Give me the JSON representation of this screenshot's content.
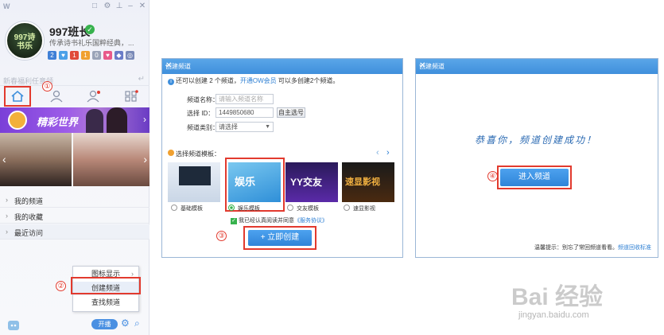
{
  "client": {
    "username": "997班长",
    "signature": "传承诗书礼乐国粹经典，...",
    "avatar_text": "997诗书乐",
    "badges": [
      {
        "text": "2",
        "color": "#3f7fd6"
      },
      {
        "text": "♥",
        "color": "#4aa0e8"
      },
      {
        "text": "1",
        "color": "#e04a3a"
      },
      {
        "text": "1",
        "color": "#f0a030"
      },
      {
        "text": "0",
        "color": "#9aa3b8"
      }
    ],
    "search_placeholder": "新春福利任意领",
    "banner_text": "精彩世界",
    "channels": [
      {
        "label": "我的频道"
      },
      {
        "label": "我的收藏"
      },
      {
        "label": "最近访问"
      }
    ],
    "context_menu": [
      {
        "label": "图标显示"
      },
      {
        "label": "创建频道"
      },
      {
        "label": "查找频道"
      }
    ],
    "open_label": "开播",
    "steps": [
      "①",
      "②",
      "③",
      "④"
    ]
  },
  "dialog1": {
    "title": "创建频道",
    "info_prefix": "还可以创建 2 个频道，",
    "info_link": "开通OW会员",
    "info_suffix": " 可以多创建2个频道。",
    "name_label": "频道名称：",
    "name_placeholder": "请输入频道名称",
    "id_label": "选择 ID：",
    "id_value": "1449850680",
    "id_button": "自主选号",
    "category_label": "频道类别：",
    "category_value": "请选择",
    "template_label": "选择频道模板：",
    "templates": [
      {
        "label": "基础模板",
        "thumb_text": ""
      },
      {
        "label": "娱乐模板",
        "thumb_text": "娱乐"
      },
      {
        "label": "交友模板",
        "thumb_text": "YY交友"
      },
      {
        "label": "速显影视",
        "thumb_text": "速显影视"
      }
    ],
    "agree_text": "我已经认真阅读并同意",
    "agree_link": "《服务协议》",
    "create_button": "+ 立即创建"
  },
  "dialog2": {
    "title": "创建频道",
    "congrats": "恭喜你，频道创建成功！",
    "enter_button": "进入频道",
    "tip_prefix": "温馨提示：别忘了常回频道看看。",
    "tip_link": "频道回收标准"
  },
  "watermark": {
    "brand": "Bai 经验",
    "url": "jingyan.baidu.com"
  },
  "colors": {
    "accent": "#3f8fdc",
    "highlight": "#e23a2e"
  }
}
